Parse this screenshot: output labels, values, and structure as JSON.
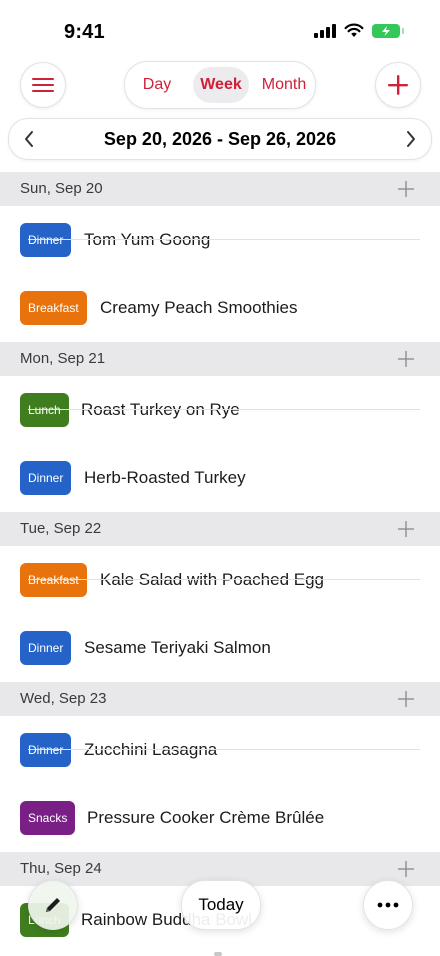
{
  "status_bar": {
    "time": "9:41"
  },
  "toolbar": {
    "view_modes": [
      {
        "label": "Day",
        "selected": false
      },
      {
        "label": "Week",
        "selected": true
      },
      {
        "label": "Month",
        "selected": false
      }
    ],
    "date_range": "Sep 20, 2026 - Sep 26, 2026"
  },
  "days": [
    {
      "label": "Sun, Sep 20",
      "meals": [
        {
          "type": "Dinner",
          "name": "Tom Yum Goong"
        },
        {
          "type": "Breakfast",
          "name": "Creamy Peach Smoothies"
        }
      ]
    },
    {
      "label": "Mon, Sep 21",
      "meals": [
        {
          "type": "Lunch",
          "name": "Roast Turkey on Rye"
        },
        {
          "type": "Dinner",
          "name": "Herb-Roasted Turkey"
        }
      ]
    },
    {
      "label": "Tue, Sep 22",
      "meals": [
        {
          "type": "Breakfast",
          "name": "Kale Salad with Poached Egg"
        },
        {
          "type": "Dinner",
          "name": "Sesame Teriyaki Salmon"
        }
      ]
    },
    {
      "label": "Wed, Sep 23",
      "meals": [
        {
          "type": "Dinner",
          "name": "Zucchini Lasagna"
        },
        {
          "type": "Snacks",
          "name": "Pressure Cooker Crème Brûlée"
        }
      ]
    },
    {
      "label": "Thu, Sep 24",
      "meals": [
        {
          "type": "Lunch",
          "name": "Rainbow Buddha Bowl"
        }
      ]
    }
  ],
  "bottom_bar": {
    "today_label": "Today"
  },
  "colors": {
    "accent": "#d0213a",
    "Dinner": "#2563c9",
    "Breakfast": "#e8720c",
    "Lunch": "#3f7d1e",
    "Snacks": "#7a1f86"
  },
  "icons": {
    "menu": "hamburger-icon",
    "add": "plus-icon",
    "prev": "chevron-left-icon",
    "next": "chevron-right-icon",
    "day_add": "plus-icon",
    "edit": "pencil-icon",
    "more": "ellipsis-icon"
  }
}
